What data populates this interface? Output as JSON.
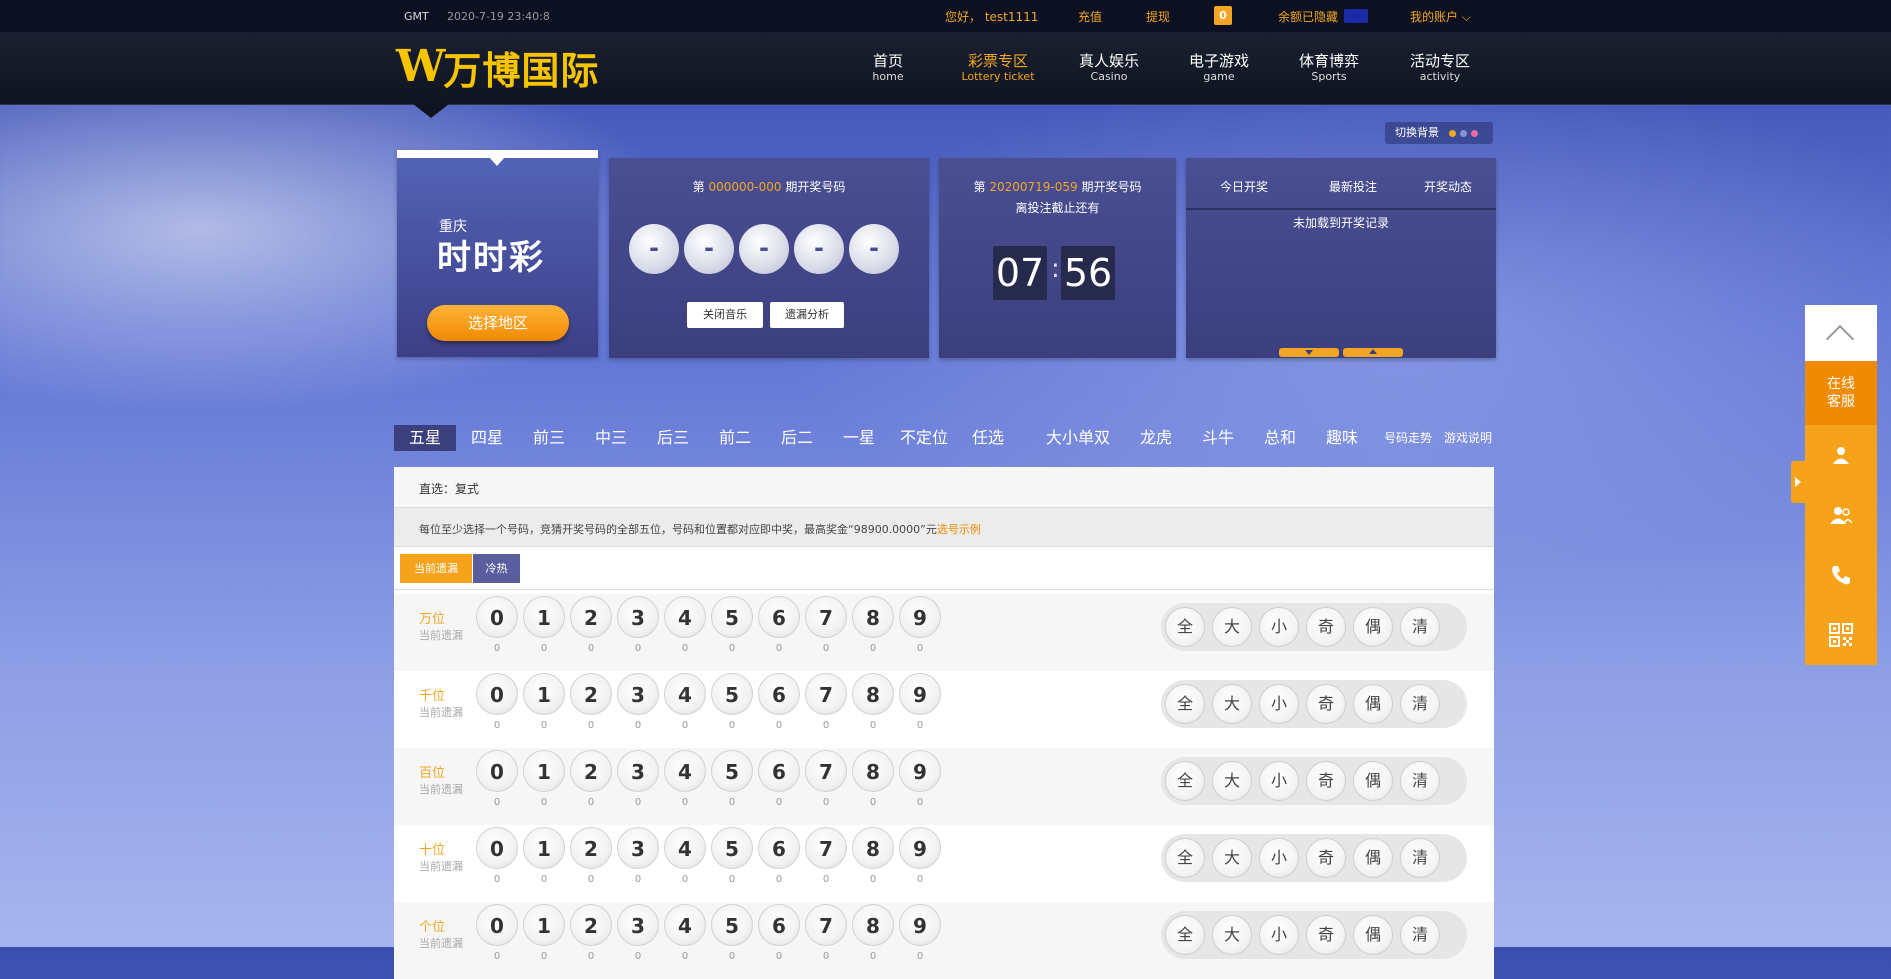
{
  "topbar": {
    "gmt": "GMT",
    "time": "2020-7-19 23:40:8",
    "greeting": "您好， test1111",
    "deposit": "充值",
    "withdraw": "提现",
    "messages": "0",
    "balance_label": "余额已隐藏",
    "account": "我的账户"
  },
  "header": {
    "logo_w": "W",
    "logo_name": "万博国际",
    "nav": [
      {
        "zh": "首页",
        "en": "home"
      },
      {
        "zh": "彩票专区",
        "en": "Lottery ticket"
      },
      {
        "zh": "真人娱乐",
        "en": "Casino"
      },
      {
        "zh": "电子游戏",
        "en": "game"
      },
      {
        "zh": "体育博弈",
        "en": "Sports"
      },
      {
        "zh": "活动专区",
        "en": "activity"
      }
    ],
    "active_nav": 1
  },
  "bg_switch": {
    "label": "切换背景",
    "dots": [
      "#f2a623",
      "#8c8fd6",
      "#e86aa8"
    ]
  },
  "region_panel": {
    "city": "重庆",
    "brand": "时时彩",
    "choose_label": "选择地区"
  },
  "draw_panel": {
    "prefix": "第",
    "issue": "000000-000",
    "suffix": "期开奖号码",
    "balls": [
      "-",
      "-",
      "-",
      "-",
      "-"
    ],
    "mute_label": "关闭音乐",
    "analysis_label": "遗漏分析"
  },
  "countdown_panel": {
    "prefix": "第",
    "issue": "20200719-059",
    "suffix": "期开奖号码",
    "sub": "离投注截止还有",
    "minutes": "07",
    "colon": ":",
    "seconds": "56"
  },
  "records_panel": {
    "tabs": [
      "今日开奖",
      "最新投注",
      "开奖动态"
    ],
    "empty": "未加载到开奖记录"
  },
  "play_tabs": [
    "五星",
    "四星",
    "前三",
    "中三",
    "后三",
    "前二",
    "后二",
    "一星",
    "不定位",
    "任选",
    "大小单双",
    "龙虎",
    "斗牛",
    "总和",
    "趣味"
  ],
  "play_links": [
    "号码走势",
    "游戏说明"
  ],
  "selection": {
    "mode": "直选：复式",
    "description": "每位至少选择一个号码，竞猜开奖号码的全部五位，号码和位置都对应即中奖，最高奖金“98900.0000”元",
    "example_link": "选号示例",
    "toggle": [
      "当前遗漏",
      "冷热"
    ]
  },
  "rows": [
    {
      "position": "万位",
      "miss_label": "当前遗漏"
    },
    {
      "position": "千位",
      "miss_label": "当前遗漏"
    },
    {
      "position": "百位",
      "miss_label": "当前遗漏"
    },
    {
      "position": "十位",
      "miss_label": "当前遗漏"
    },
    {
      "position": "个位",
      "miss_label": "当前遗漏"
    }
  ],
  "numbers": [
    "0",
    "1",
    "2",
    "3",
    "4",
    "5",
    "6",
    "7",
    "8",
    "9"
  ],
  "miss_counts": [
    "0",
    "0",
    "0",
    "0",
    "0",
    "0",
    "0",
    "0",
    "0",
    "0"
  ],
  "filters": [
    "全",
    "大",
    "小",
    "奇",
    "偶",
    "清"
  ],
  "side_widget": {
    "service": "在线客服",
    "icons": [
      "user-icon",
      "users-icon",
      "phone-icon",
      "qrcode-icon"
    ]
  }
}
